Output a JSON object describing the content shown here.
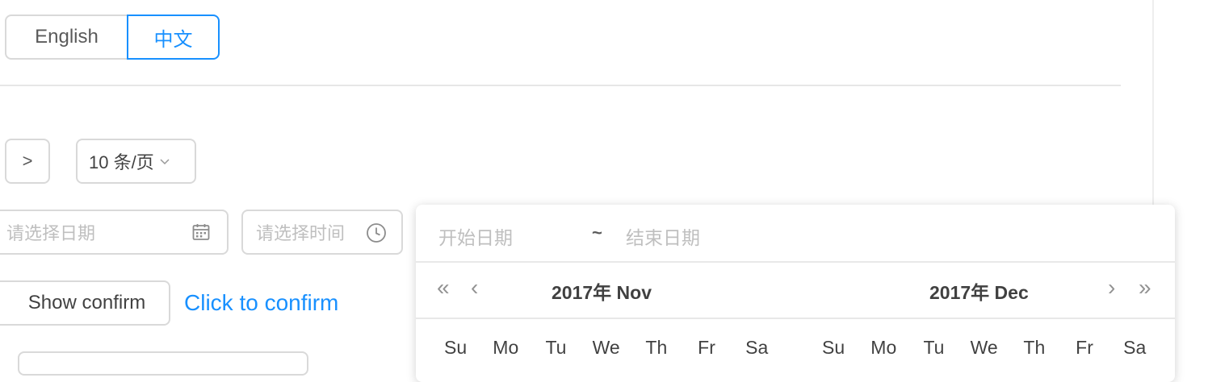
{
  "lang": {
    "english": "English",
    "chinese": "中文"
  },
  "pagination": {
    "next": ">",
    "page_size": "10 条/页"
  },
  "pickers": {
    "date_placeholder": "请选择日期",
    "time_placeholder": "请选择时间"
  },
  "confirm": {
    "button": "Show confirm",
    "link": "Click to confirm"
  },
  "range": {
    "start_placeholder": "开始日期",
    "separator": "~",
    "end_placeholder": "结束日期",
    "prev_year": "«",
    "prev_month": "‹",
    "next_month": "›",
    "next_year": "»",
    "left_month": "2017年 Nov",
    "right_month": "2017年 Dec",
    "weekdays": [
      "Su",
      "Mo",
      "Tu",
      "We",
      "Th",
      "Fr",
      "Sa"
    ]
  },
  "colors": {
    "primary": "#1890ff",
    "border": "#d9d9d9",
    "placeholder": "#bfbfbf"
  }
}
